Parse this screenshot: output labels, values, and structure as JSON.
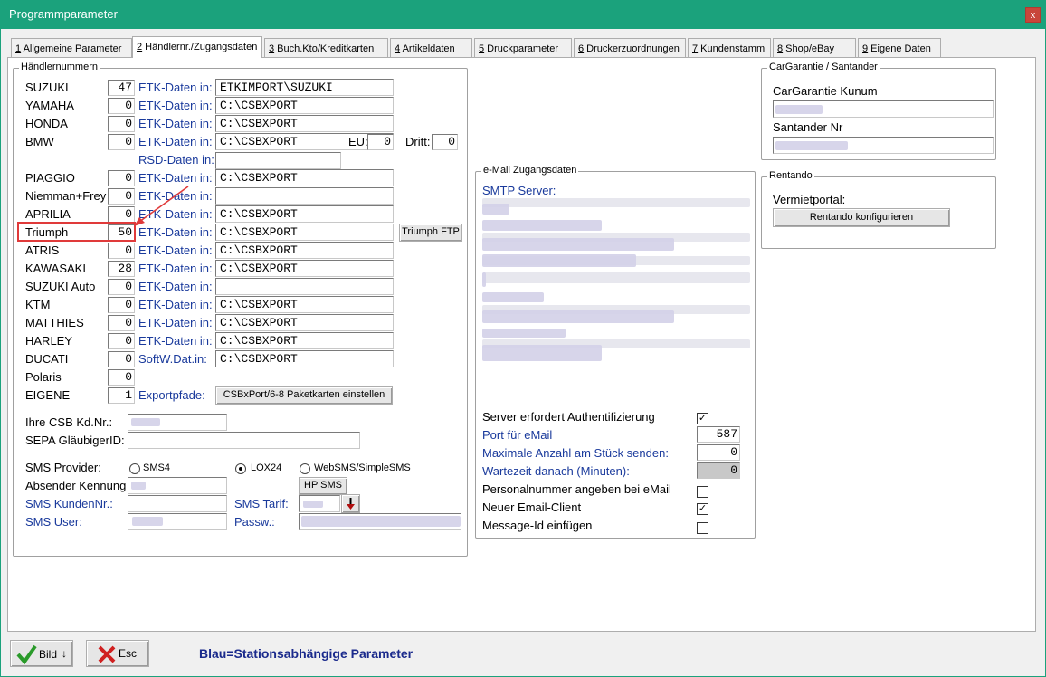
{
  "window": {
    "title": "Programmparameter",
    "close_label": "x"
  },
  "tabs": [
    {
      "key": "1",
      "label": " Allgemeine Parameter"
    },
    {
      "key": "2",
      "label": " Händlernr./Zugangsdaten"
    },
    {
      "key": "3",
      "label": " Buch.Kto/Kreditkarten"
    },
    {
      "key": "4",
      "label": " Artikeldaten"
    },
    {
      "key": "5",
      "label": " Druckparameter"
    },
    {
      "key": "6",
      "label": " Druckerzuordnungen"
    },
    {
      "key": "7",
      "label": " Kundenstamm"
    },
    {
      "key": "8",
      "label": " Shop/eBay"
    },
    {
      "key": "9",
      "label": " Eigene Daten"
    }
  ],
  "dealers": {
    "group_title": "Händlernummern",
    "etk_label": "ETK-Daten in:",
    "rows": [
      {
        "name": "SUZUKI",
        "number": "47",
        "path": "ETKIMPORT\\SUZUKI"
      },
      {
        "name": "YAMAHA",
        "number": "0",
        "path": "C:\\CSBXPORT"
      },
      {
        "name": "HONDA",
        "number": "0",
        "path": "C:\\CSBXPORT"
      },
      {
        "name": "BMW",
        "number": "0",
        "path": "C:\\CSBXPORT"
      },
      {
        "name": "PIAGGIO",
        "number": "0",
        "path": "C:\\CSBXPORT"
      },
      {
        "name": "Niemman+Frey",
        "number": "0",
        "path": ""
      },
      {
        "name": "APRILIA",
        "number": "0",
        "path": "C:\\CSBXPORT"
      },
      {
        "name": "Triumph",
        "number": "50",
        "path": "C:\\CSBXPORT"
      },
      {
        "name": "ATRIS",
        "number": "0",
        "path": "C:\\CSBXPORT"
      },
      {
        "name": "KAWASAKI",
        "number": "28",
        "path": "C:\\CSBXPORT"
      },
      {
        "name": "SUZUKI Auto",
        "number": "0",
        "path": ""
      },
      {
        "name": "KTM",
        "number": "0",
        "path": "C:\\CSBXPORT"
      },
      {
        "name": "MATTHIES",
        "number": "0",
        "path": "C:\\CSBXPORT"
      },
      {
        "name": "HARLEY",
        "number": "0",
        "path": "C:\\CSBXPORT"
      },
      {
        "name": "DUCATI",
        "number": "0",
        "path": "C:\\CSBXPORT"
      },
      {
        "name": "Polaris",
        "number": "0"
      },
      {
        "name": "EIGENE",
        "number": "1"
      }
    ],
    "ducati_label": "SoftW.Dat.in:",
    "rsd_label": "RSD-Daten in:",
    "rsd_value": "",
    "eu_label": "EU:",
    "eu_value": "0",
    "dritt_label": "Dritt:",
    "dritt_value": "0",
    "triumph_ftp_button": "Triumph FTP",
    "export_label": "Exportpfade:",
    "export_button": "CSBxPort/6-8 Paketkarten einstellen"
  },
  "customer": {
    "csb_label": "Ihre CSB Kd.Nr.:",
    "sepa_label": "SEPA GläubigerID:",
    "sepa_value": ""
  },
  "sms": {
    "provider_label": "SMS Provider:",
    "providers": [
      "SMS4",
      "LOX24",
      "WebSMS/SimpleSMS"
    ],
    "selected": "LOX24",
    "sender_label": "Absender Kennung",
    "hp_button": "HP SMS",
    "kunden_label": "SMS KundenNr.:",
    "tarif_label": "SMS Tarif:",
    "user_label": "SMS User:",
    "pass_label": "Passw.:"
  },
  "email": {
    "group_title": "e-Mail Zugangsdaten",
    "smtp_label": "SMTP Server:",
    "auth_label": "Server erfordert Authentifizierung",
    "auth_checked": true,
    "port_label": "Port für eMail",
    "port_value": "587",
    "max_label": "Maximale Anzahl am Stück senden:",
    "max_value": "0",
    "wait_label": "Wartezeit danach (Minuten):",
    "wait_value": "0",
    "personal_label": "Personalnummer angeben bei eMail",
    "personal_checked": false,
    "newclient_label": "Neuer Email-Client",
    "newclient_checked": true,
    "msgid_label": "Message-Id einfügen",
    "msgid_checked": false
  },
  "cargarantie": {
    "group_title": "CarGarantie / Santander",
    "kunum_label": "CarGarantie Kunum",
    "santander_label": "Santander Nr"
  },
  "rentando": {
    "group_title": "Rentando",
    "portal_label": "Vermietportal:",
    "config_button": "Rentando konfigurieren"
  },
  "footer": {
    "ok_label": "Bild",
    "esc_label": "Esc",
    "note": "Blau=Stationsabhängige Parameter"
  },
  "colors": {
    "titlebar": "#1ba27c",
    "station_blue": "#1a3a9c",
    "highlight": "#e03a3a"
  }
}
